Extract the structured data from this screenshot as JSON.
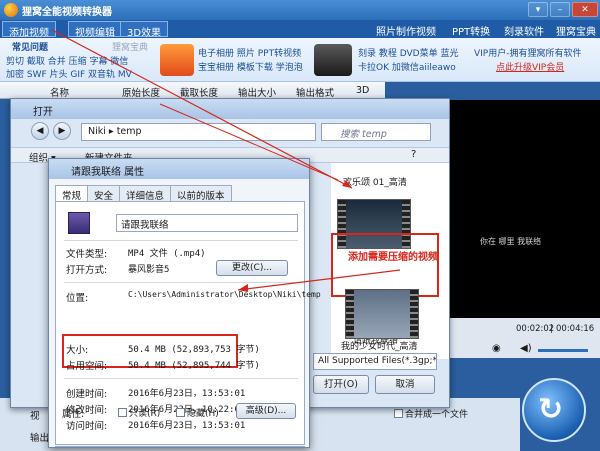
{
  "app": {
    "title": "狸窝全能视频转换器",
    "tabs": [
      "添加视频",
      "视频编辑",
      "3D效果"
    ],
    "top_links": [
      "照片制作视频",
      "PPT转换",
      "刻录软件",
      "狸窝宝典"
    ],
    "common_issues": "常见问题",
    "promo_tag": "狸窝宝典",
    "promo_left": "剪切 截取 合并 压缩 字幕 微信",
    "promo_left2": "加密 SWF 片头 GIF 双音轨 MV",
    "promo_mid1": "电子相册 照片 PPT转视频",
    "promo_mid2": "宝宝相册 模板下载 学泡泡",
    "promo_right1": "刻录 教程 DVD菜单 蓝光",
    "promo_right2": "卡拉OK 加微信aiileawo",
    "vip_line1": "VIP用户-拥有狸窝所有软件",
    "vip_line2": "点此升级VIP会员",
    "columns": [
      "名称",
      "原始长度",
      "截取长度",
      "输出大小",
      "输出格式",
      "3D"
    ],
    "video_caption": "你在 哪里          我联络",
    "time_current": "00:02:02",
    "time_total": "00:04:16",
    "bottom_label1": "视",
    "bottom_label2": "输出",
    "merge_checkbox": "合并成一个文件",
    "accent_color": "#1f5ba6",
    "highlight_color": "#d7261b"
  },
  "open_dialog": {
    "title": "打开",
    "breadcrumb": "Niki ▸ temp",
    "search_placeholder": "搜索 temp",
    "organize": "组织 ▾",
    "new_folder": "新建文件夹",
    "files": [
      {
        "name": "欢乐颂 01_高清"
      },
      {
        "name": "请跟我联络"
      },
      {
        "name": "我的少女时代_高清"
      }
    ],
    "file_type": "All Supported Files(*.3gp;*.3g",
    "open_button": "打开(O)",
    "cancel_button": "取消"
  },
  "properties": {
    "title": "请跟我联络 属性",
    "tabs": [
      "常规",
      "安全",
      "详细信息",
      "以前的版本"
    ],
    "file_name": "请跟我联络",
    "file_type_label": "文件类型:",
    "file_type_value": "MP4 文件 (.mp4)",
    "open_with_label": "打开方式:",
    "open_with_value": "暴风影音5",
    "change_button": "更改(C)...",
    "location_label": "位置:",
    "location_value": "C:\\Users\\Administrator\\Desktop\\Niki\\temp",
    "size_label": "大小:",
    "size_value": "50.4 MB (52,893,753 字节)",
    "disk_size_label": "占用空间:",
    "disk_size_value": "50.4 MB (52,895,744 字节)",
    "created_label": "创建时间:",
    "created_value": "2016年6月23日，13:53:01",
    "modified_label": "修改时间:",
    "modified_value": "2016年6月23日，10:22:04",
    "accessed_label": "访问时间:",
    "accessed_value": "2016年6月23日，13:53:01",
    "attributes_label": "属性:",
    "readonly": "只读(R)",
    "hidden": "隐藏(H)",
    "advanced_button": "高级(D)..."
  },
  "annotation": "添加需要压缩的视频"
}
